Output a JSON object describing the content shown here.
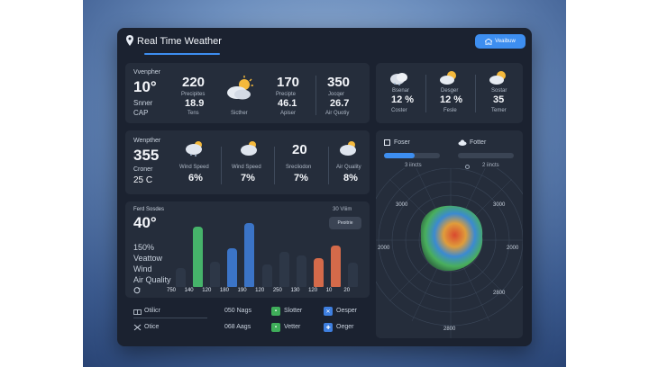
{
  "header": {
    "title": "Real Time Weather",
    "button_label": "Veaibuw"
  },
  "left_top": {
    "label": "Vvenpher",
    "temp": "10°",
    "line1": "Snner",
    "line2": "CAP",
    "col1": {
      "value": "220",
      "label": "Precipites",
      "sub": "18.9",
      "sub2": "Tens"
    },
    "col2": {
      "label": "Sicther"
    },
    "col3": {
      "value": "170",
      "label": "Precipte",
      "sub": "46.1",
      "sub2": "Apiser"
    },
    "col4": {
      "value": "350",
      "label": "Jocqer",
      "sub": "26.7",
      "sub2": "Air Quotiy"
    }
  },
  "right_top": {
    "items": [
      {
        "label": "Bsenar",
        "value": "12 %",
        "sub": "Coster"
      },
      {
        "label": "Desger",
        "value": "12 %",
        "sub": "Fesle"
      },
      {
        "label": "Sostar",
        "value": "35",
        "sub": "Temer"
      }
    ]
  },
  "left_mid": {
    "label": "Wenpther",
    "value": "355",
    "line1": "Croner",
    "line2": "25 C",
    "items": [
      {
        "label": "Wind Speed",
        "value": "6%"
      },
      {
        "label": "Wind Speed",
        "value": "7%"
      },
      {
        "top": "20",
        "label": "Srecliodon",
        "value": "7%"
      },
      {
        "label": "Air Quality",
        "value": "8%"
      }
    ]
  },
  "left_bot": {
    "title": "Ferd Sosdes",
    "temp": "40°",
    "right_label": "30 Vliim",
    "button_label": "Peoitrie",
    "lines": [
      "150%",
      "Veattow",
      "Wind",
      "Air Quality"
    ],
    "x_labels": [
      "750",
      "140",
      "120",
      "180",
      "190",
      "120",
      "250",
      "130",
      "120",
      "10",
      "20"
    ]
  },
  "chart_data": {
    "type": "bar",
    "categories": [
      "750",
      "140",
      "120",
      "180",
      "190",
      "120",
      "250",
      "130",
      "120",
      "10",
      "20"
    ],
    "values": [
      0.3,
      0.95,
      0.4,
      0.6,
      1.0,
      0.35,
      0.55,
      0.5,
      0.45,
      0.65,
      0.38
    ],
    "colors": [
      "#2d3747",
      "#46b36a",
      "#2d3747",
      "#3b74c7",
      "#3b74c7",
      "#2d3747",
      "#2d3747",
      "#2d3747",
      "#d46a4a",
      "#d46a4a",
      "#2d3747"
    ]
  },
  "footer": {
    "rows": [
      {
        "left": "Otilicr",
        "mid": "050 Nags",
        "badge_label": "Slotter",
        "badge2_label": "Oesper"
      },
      {
        "left": "Otice",
        "mid": "068 Aags",
        "badge_label": "Vetter",
        "badge2_label": "Oeger"
      }
    ]
  },
  "right_bot": {
    "toggle1": "Foser",
    "toggle2": "Fotter",
    "sub1": "3 iincts",
    "sub2": "2 iincts",
    "progress": 0.55,
    "radar_labels": [
      "3000",
      "3000",
      "2000",
      "2000",
      "2800",
      "2800"
    ]
  }
}
